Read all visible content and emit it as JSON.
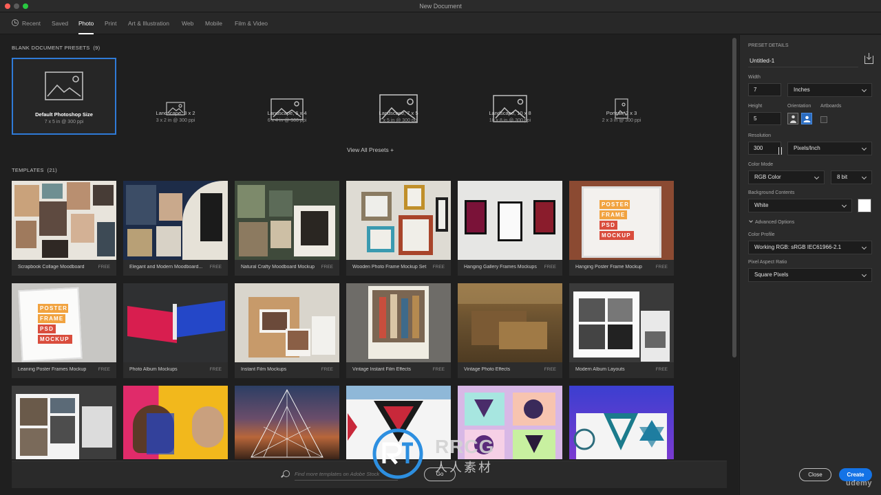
{
  "window": {
    "title": "New Document"
  },
  "tabs": [
    {
      "label": "Recent",
      "icon": "clock-icon"
    },
    {
      "label": "Saved"
    },
    {
      "label": "Photo",
      "active": true
    },
    {
      "label": "Print"
    },
    {
      "label": "Art & Illustration"
    },
    {
      "label": "Web"
    },
    {
      "label": "Mobile"
    },
    {
      "label": "Film & Video"
    }
  ],
  "presets": {
    "heading": "BLANK DOCUMENT PRESETS",
    "count": "(9)",
    "items": [
      {
        "name": "Default Photoshop Size",
        "sub": "7 x 5 in @ 300 ppi",
        "selected": true
      },
      {
        "name": "Landscape, 3 x 2",
        "sub": "3 x 2 in @ 300 ppi"
      },
      {
        "name": "Landscape, 6 x 4",
        "sub": "6 x 4 in @ 300 ppi"
      },
      {
        "name": "Landscape, 7 x 5",
        "sub": "7 x 5 in @ 300 ppi"
      },
      {
        "name": "Landscape, 10 x 8",
        "sub": "10 x 8 in @ 300 ppi"
      },
      {
        "name": "Portrait, 2 x 3",
        "sub": "2 x 3 in @ 300 ppi"
      }
    ],
    "view_all": "View All Presets +"
  },
  "templates": {
    "heading": "TEMPLATES",
    "count": "(21)",
    "items": [
      {
        "name": "Scrapbook Collage Moodboard",
        "badge": "FREE"
      },
      {
        "name": "Elegant and Modern Moodboard...",
        "badge": "FREE"
      },
      {
        "name": "Natural Crafty Moodboard Mockup",
        "badge": "FREE"
      },
      {
        "name": "Wooden Photo Frame Mockup Set",
        "badge": "FREE"
      },
      {
        "name": "Hanging Gallery Frames Mockups",
        "badge": "FREE"
      },
      {
        "name": "Hanging Poster Frame Mockup",
        "badge": "FREE"
      },
      {
        "name": "Leaning Poster Frames Mockup",
        "badge": "FREE"
      },
      {
        "name": "Photo Album Mockups",
        "badge": "FREE"
      },
      {
        "name": "Instant Film Mockups",
        "badge": "FREE"
      },
      {
        "name": "Vintage Instant Film Effects",
        "badge": "FREE"
      },
      {
        "name": "Vintage Photo Effects",
        "badge": "FREE"
      },
      {
        "name": "Modern Album Layouts",
        "badge": "FREE"
      }
    ],
    "poster_words": [
      "POSTER",
      "FRAME",
      "PSD",
      "MOCKUP"
    ]
  },
  "search": {
    "placeholder": "Find more templates on Adobe Stock",
    "go_label": "Go"
  },
  "details": {
    "heading": "PRESET DETAILS",
    "document_name": "Untitled-1",
    "width_label": "Width",
    "width_value": "7",
    "width_unit": "Inches",
    "height_label": "Height",
    "height_value": "5",
    "orientation_label": "Orientation",
    "artboards_label": "Artboards",
    "resolution_label": "Resolution",
    "resolution_value": "300",
    "resolution_unit": "Pixels/Inch",
    "color_mode_label": "Color Mode",
    "color_mode": "RGB Color",
    "bit_depth": "8 bit",
    "background_label": "Background Contents",
    "background": "White",
    "advanced": "Advanced Options",
    "profile_label": "Color Profile",
    "profile": "Working RGB: sRGB IEC61966-2.1",
    "aspect_label": "Pixel Aspect Ratio",
    "aspect": "Square Pixels"
  },
  "actions": {
    "close": "Close",
    "create": "Create"
  },
  "watermark": {
    "brand": "RRCG",
    "sub": "人人素材",
    "site": "udemy"
  },
  "colors": {
    "accent": "#1473e6",
    "selection": "#2f7bd8",
    "panel": "#2a2a2a",
    "background": "#1f1f1f"
  }
}
